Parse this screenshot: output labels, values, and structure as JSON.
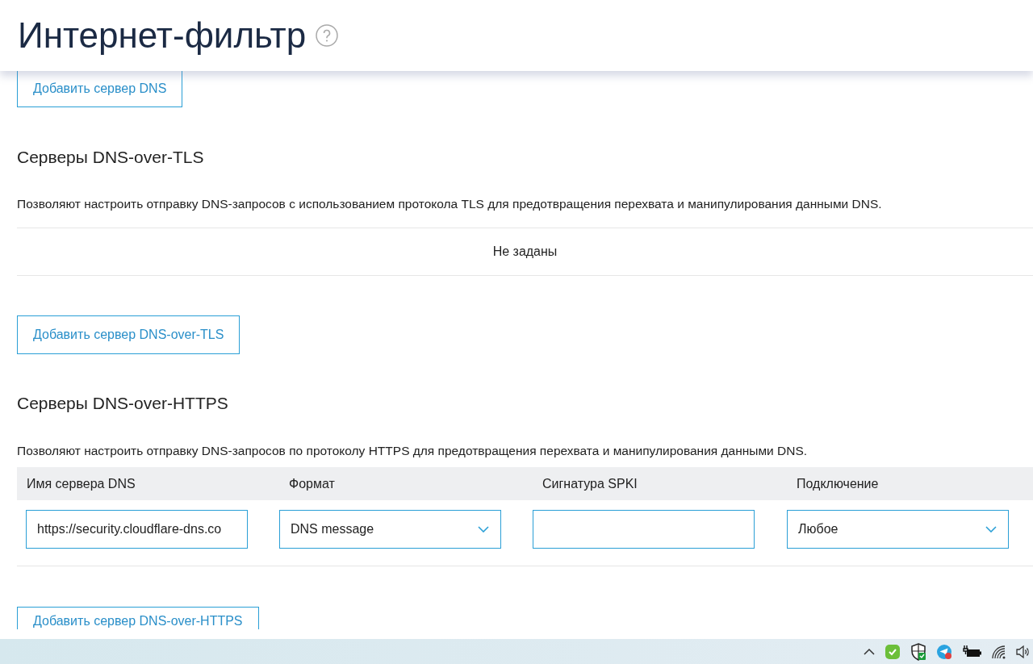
{
  "header": {
    "title": "Интернет-фильтр"
  },
  "dns_section": {
    "add_button": "Добавить сервер DNS"
  },
  "dot_section": {
    "heading": "Серверы DNS-over-TLS",
    "description": "Позволяют настроить отправку DNS-запросов с использованием протокола TLS для предотвращения перехвата и манипулирования данными DNS.",
    "empty_text": "Не заданы",
    "add_button": "Добавить сервер DNS-over-TLS"
  },
  "doh_section": {
    "heading": "Серверы DNS-over-HTTPS",
    "description": "Позволяют настроить отправку DNS-запросов по протоколу HTTPS для предотвращения перехвата и манипулирования данными DNS.",
    "columns": [
      "Имя сервера DNS",
      "Формат",
      "Сигнатура SPKI",
      "Подключение"
    ],
    "rows": [
      {
        "cells": [
          {
            "kind": "text",
            "value": "https://security.cloudflare-dns.co"
          },
          {
            "kind": "select",
            "value": "DNS message"
          },
          {
            "kind": "text"
          },
          {
            "kind": "select",
            "value": "Любое"
          }
        ]
      }
    ],
    "add_button": "Добавить сервер DNS-over-HTTPS"
  }
}
